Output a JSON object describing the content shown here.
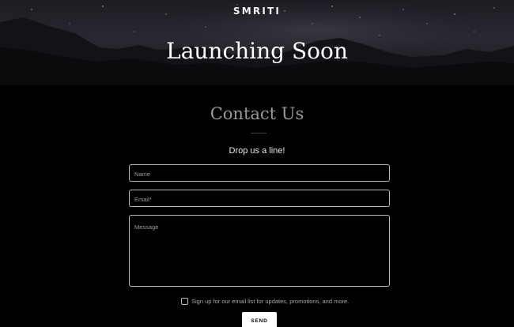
{
  "header": {
    "brand": "SMRITI",
    "headline": "Launching Soon"
  },
  "contact": {
    "title": "Contact Us",
    "subtitle": "Drop us a line!",
    "name_placeholder": "Name",
    "email_placeholder": "Email*",
    "message_placeholder": "Message",
    "optin_label": "Sign up for our email list for updates, promotions, and more.",
    "optin_checked": false,
    "send_label": "SEND"
  },
  "colors": {
    "hero_sky": "#25222b",
    "mountains": "#0f0d10",
    "page_background": "#000000",
    "button": "#ffffff"
  }
}
